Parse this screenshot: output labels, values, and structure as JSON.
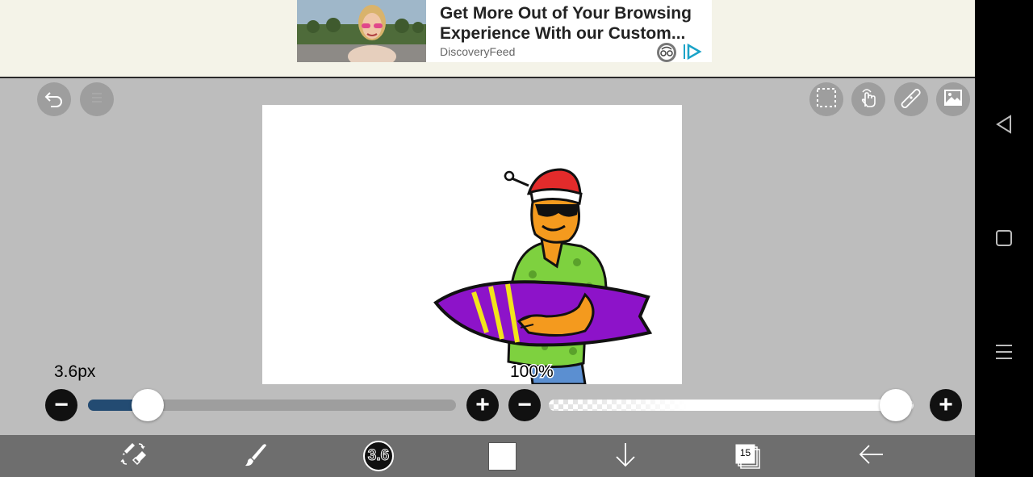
{
  "ad": {
    "title": "Get More Out of Your Browsing Experience With our Custom...",
    "source": "DiscoveryFeed"
  },
  "brush": {
    "size_label": "3.6px",
    "size_fraction": 0.13,
    "badge": "3.6"
  },
  "opacity": {
    "label": "100%",
    "fraction": 1.0
  },
  "color": {
    "current": "#ffffff",
    "size_fill": "#234b72"
  },
  "layers": {
    "count": "15"
  },
  "icons": {
    "top_left": [
      "undo-icon",
      "redo-icon"
    ],
    "top_right": [
      "selection-icon",
      "hand-icon",
      "ruler-icon",
      "image-icon"
    ],
    "toolbar": [
      "swap-pen-eraser-icon",
      "brush-icon",
      "brush-size-badge",
      "color-swatch",
      "arrow-down-icon",
      "layers-icon",
      "arrow-left-icon"
    ]
  }
}
